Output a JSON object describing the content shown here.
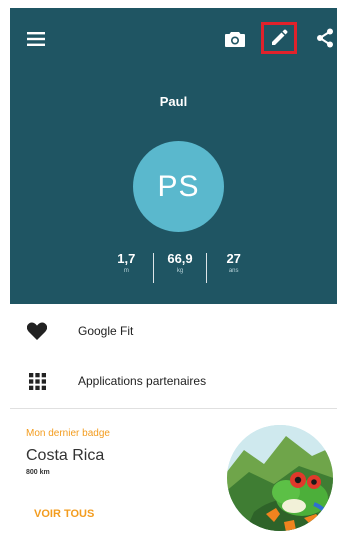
{
  "profile": {
    "name": "Paul",
    "initials": "PS",
    "stats": [
      {
        "value": "1,7",
        "unit": "m"
      },
      {
        "value": "66,9",
        "unit": "kg"
      },
      {
        "value": "27",
        "unit": "ans"
      }
    ]
  },
  "toolbar": {
    "icons": [
      "menu-icon",
      "camera-icon",
      "edit-icon",
      "share-icon"
    ]
  },
  "list": [
    {
      "icon": "heart-icon",
      "label": "Google Fit"
    },
    {
      "icon": "apps-grid-icon",
      "label": "Applications partenaires"
    }
  ],
  "badge": {
    "title": "Mon dernier badge",
    "name": "Costa Rica",
    "distance": "800 km",
    "see_all": "VOIR TOUS",
    "image_icon": "tree-frog-badge"
  },
  "colors": {
    "header_bg": "#1f5563",
    "avatar_bg": "#5ab8cd",
    "accent": "#f39c1e",
    "highlight": "#e0222b"
  }
}
